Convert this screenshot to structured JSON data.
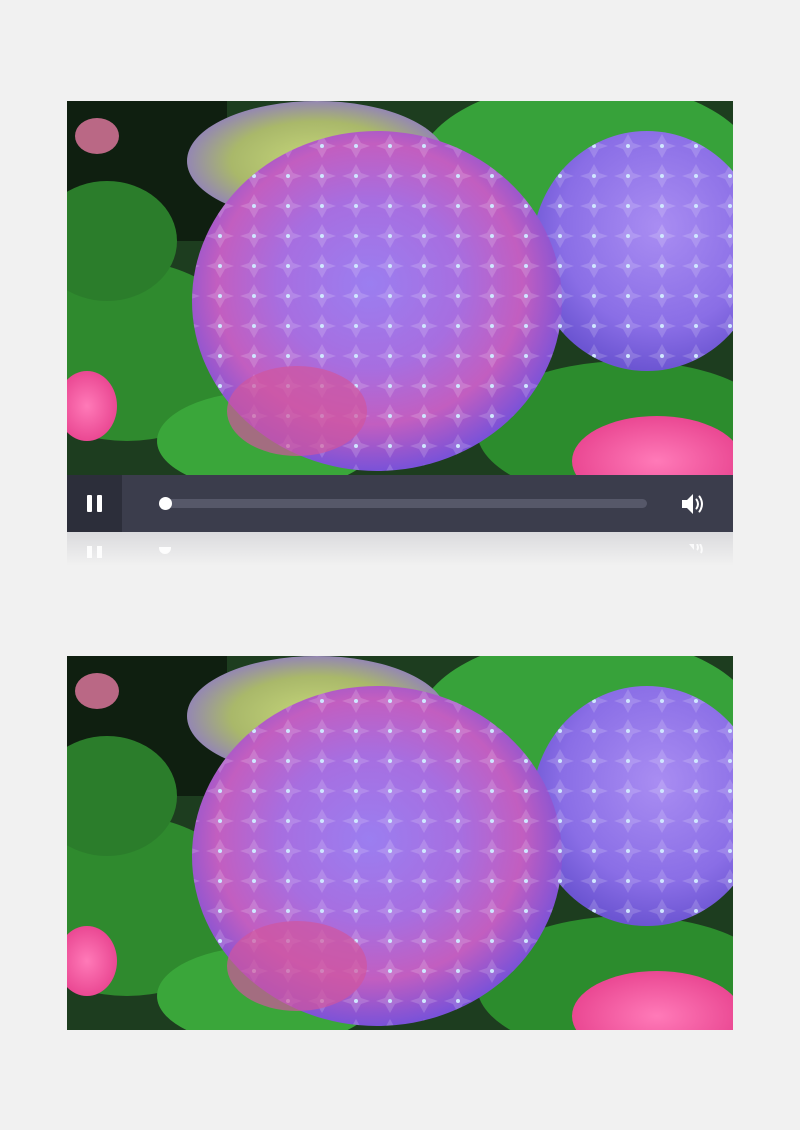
{
  "player": {
    "state": "playing",
    "progress_fraction": 0.0,
    "controls": {
      "pause_icon": "pause-icon",
      "volume_icon": "volume-icon"
    },
    "colors": {
      "control_bar": "#3b3d4c",
      "pause_button_bg": "#2c2e3a",
      "track": "#565869",
      "knob": "#ffffff"
    }
  },
  "frames": [
    {
      "subject": "hydrangea"
    },
    {
      "subject": "hydrangea"
    }
  ]
}
